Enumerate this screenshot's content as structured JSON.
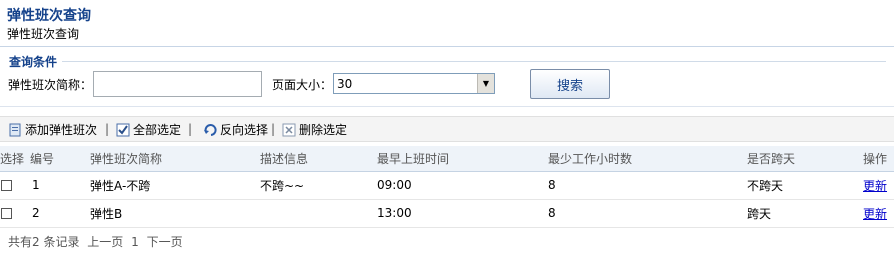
{
  "header": {
    "title": "弹性班次查询",
    "subtitle": "弹性班次查询"
  },
  "filter": {
    "legend": "查询条件",
    "name_label": "弹性班次简称：",
    "name_value": "",
    "page_size_label": "页面大小：",
    "page_size_value": "30",
    "search_label": "搜索"
  },
  "toolbar": {
    "add_label": "添加弹性班次",
    "select_all_label": "全部选定",
    "invert_label": "反向选择",
    "delete_label": "删除选定",
    "separator": "|"
  },
  "table": {
    "columns": [
      "选择",
      "编号",
      "弹性班次简称",
      "描述信息",
      "最早上班时间",
      "最少工作小时数",
      "是否跨天",
      "操作"
    ],
    "rows": [
      {
        "id": "1",
        "name": "弹性A-不跨",
        "desc": "不跨~~",
        "start": "09:00",
        "hours": "8",
        "cross_day": "不跨天",
        "action": "更新"
      },
      {
        "id": "2",
        "name": "弹性B",
        "desc": "",
        "start": "13:00",
        "hours": "8",
        "cross_day": "跨天",
        "action": "更新"
      }
    ]
  },
  "pager": {
    "summary": "共有2 条记录",
    "prev": "上一页",
    "current": "1",
    "next": "下一页"
  },
  "colors": {
    "title": "#15428b",
    "link": "#0000cc",
    "header_bg": "#eef3f9",
    "toolbar_bg": "#f4f4f4"
  }
}
